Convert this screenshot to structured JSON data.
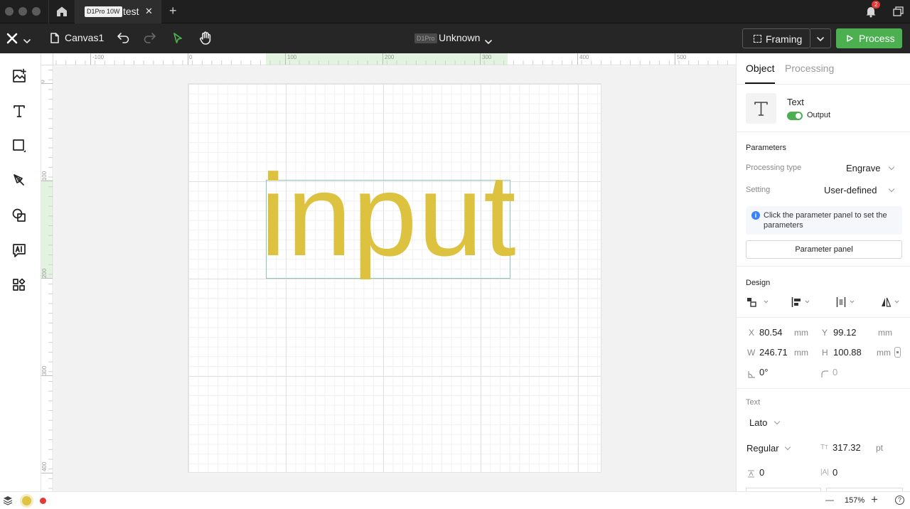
{
  "titlebar": {
    "tab": {
      "badge": "D1Pro 10W",
      "title": "test",
      "close": "✕"
    },
    "new_tab": "+",
    "notification_count": "2"
  },
  "toolbar": {
    "canvas_name": "Canvas1",
    "device_badge": "D1Pro",
    "device_status": "Unknown",
    "framing_label": "Framing",
    "process_label": "Process"
  },
  "ruler": {
    "top_ticks": [
      "-100",
      "0",
      "100",
      "200",
      "300",
      "400",
      "500"
    ],
    "left_ticks": [
      "0",
      "100",
      "200",
      "300",
      "400"
    ]
  },
  "canvas": {
    "text": "input",
    "text_color": "#dcc23e",
    "selection_color": "#8ec7b8"
  },
  "panel": {
    "tabs": [
      "Object",
      "Processing"
    ],
    "object_type": "Text",
    "output_label": "Output",
    "output_on": true,
    "parameters_heading": "Parameters",
    "processing_type_label": "Processing type",
    "processing_type_value": "Engrave",
    "setting_label": "Setting",
    "setting_value": "User-defined",
    "info_text": "Click the parameter panel to set the parameters",
    "parameter_button": "Parameter panel",
    "design_heading": "Design",
    "x_label": "X",
    "x_value": "80.54",
    "x_unit": "mm",
    "y_label": "Y",
    "y_value": "99.12",
    "y_unit": "mm",
    "w_label": "W",
    "w_value": "246.71",
    "w_unit": "mm",
    "h_label": "H",
    "h_value": "100.88",
    "h_unit": "mm",
    "rotation_value": "0°",
    "corner_value": "0",
    "text_heading": "Text",
    "font_value": "Lato",
    "style_value": "Regular",
    "size_value": "317.32",
    "size_unit": "pt",
    "line_spacing_value": "0",
    "letter_spacing_value": "0"
  },
  "status": {
    "zoom": "157%",
    "minus": "—",
    "plus": "+",
    "help": "?",
    "accent_green": "#4caf50",
    "status_red": "#e53935",
    "status_yellow": "#e0c341"
  }
}
